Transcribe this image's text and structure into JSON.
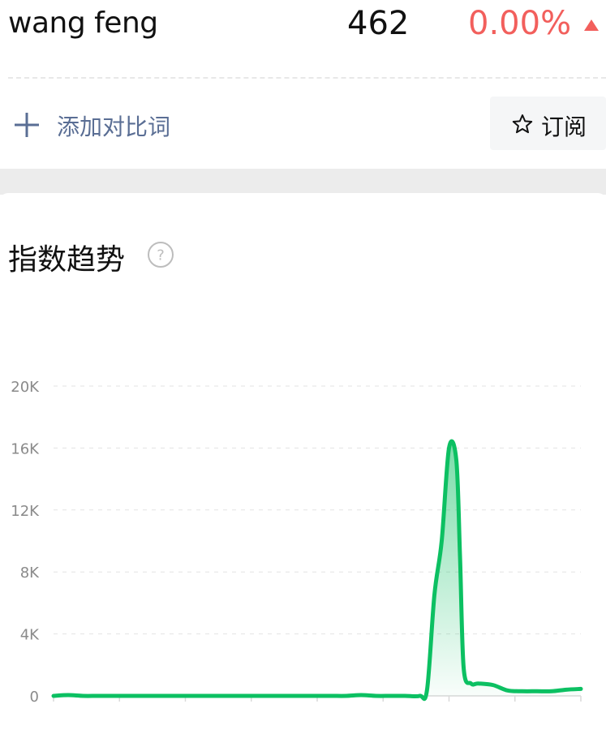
{
  "header": {
    "keyword": "wang feng",
    "value": "462",
    "change": "0.00%",
    "change_direction_icon": "triangle-up-icon"
  },
  "actions": {
    "add_compare_label": "添加对比词",
    "add_icon": "plus-icon",
    "subscribe_label": "订阅",
    "subscribe_icon": "star-icon"
  },
  "section": {
    "title": "指数趋势",
    "help_icon": "question-circle-icon"
  },
  "colors": {
    "line": "#0cc062",
    "change_up": "#f25f5c",
    "link": "#5a6e94"
  },
  "chart_data": {
    "type": "area",
    "y_ticks": [
      "20K",
      "16K",
      "12K",
      "8K",
      "4K",
      "0"
    ],
    "ylim": [
      0,
      20000
    ],
    "xlim": [
      0,
      72
    ],
    "grid": true,
    "series": [
      {
        "x": [
          0,
          2,
          4,
          6,
          8,
          10,
          12,
          14,
          16,
          18,
          20,
          22,
          24,
          26,
          28,
          30,
          32,
          34,
          36,
          38,
          40,
          42,
          44,
          46,
          48,
          50,
          51,
          52,
          53,
          54,
          55,
          55.5,
          56,
          57,
          58,
          60,
          62,
          64,
          66,
          68,
          70,
          72
        ],
        "values": [
          0,
          50,
          0,
          0,
          0,
          0,
          0,
          0,
          0,
          0,
          0,
          0,
          0,
          0,
          0,
          0,
          0,
          0,
          0,
          0,
          0,
          50,
          0,
          0,
          0,
          0,
          400,
          6500,
          10000,
          16000,
          15200,
          9000,
          1800,
          800,
          800,
          700,
          350,
          300,
          300,
          300,
          400,
          450
        ]
      }
    ]
  }
}
